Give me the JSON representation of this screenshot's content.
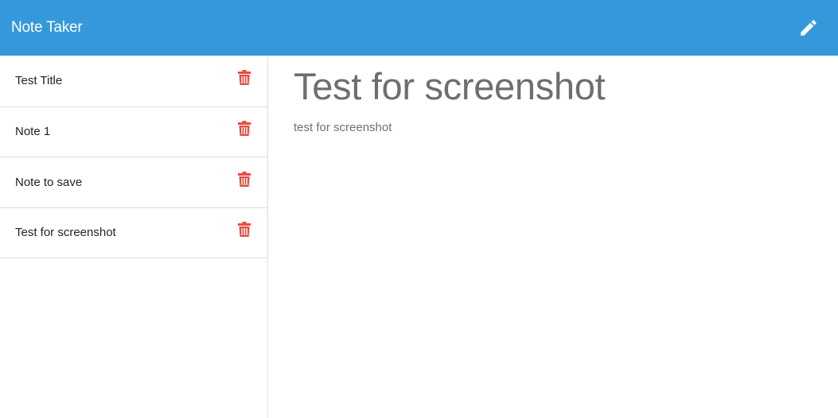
{
  "navbar": {
    "brand": "Note Taker",
    "new_note_icon": "pencil-icon"
  },
  "notes": [
    {
      "title": "Test Title",
      "delete_icon": "trash-icon"
    },
    {
      "title": "Note 1",
      "delete_icon": "trash-icon"
    },
    {
      "title": "Note to save",
      "delete_icon": "trash-icon"
    },
    {
      "title": "Test for screenshot",
      "delete_icon": "trash-icon"
    }
  ],
  "active_note": {
    "title": "Test for screenshot",
    "text": "test for screenshot"
  },
  "colors": {
    "navbar": "#3498db",
    "delete_icon": "#e74c3c"
  }
}
